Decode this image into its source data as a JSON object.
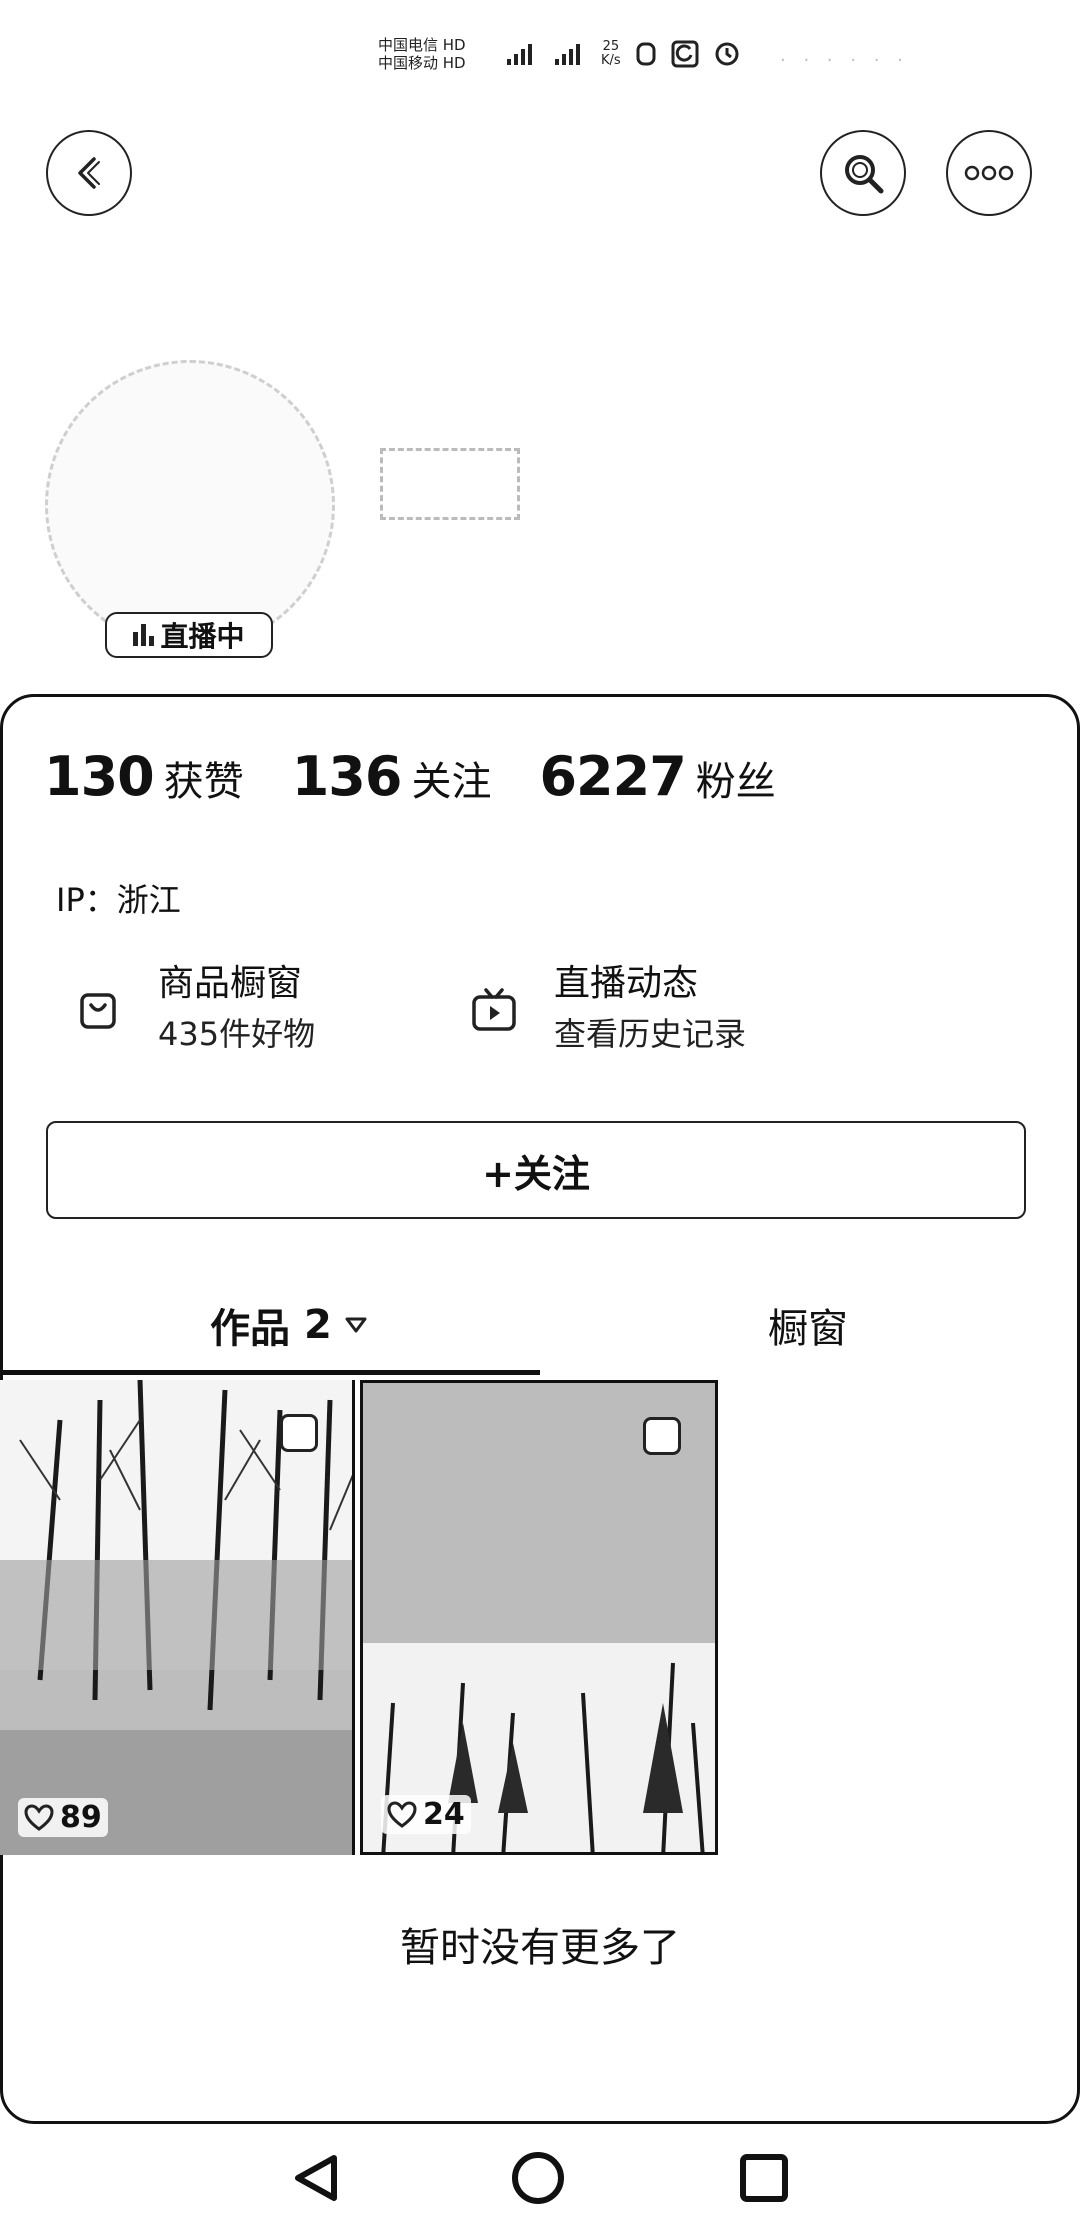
{
  "status_bar": {
    "carrier_line1": "中国电信 HD",
    "carrier_line2": "中国移动 HD",
    "net_speed_value": "25",
    "net_speed_unit": "K/s"
  },
  "header": {
    "live_badge": "直播中"
  },
  "stats": [
    {
      "value": "130",
      "label": "获赞"
    },
    {
      "value": "136",
      "label": "关注"
    },
    {
      "value": "6227",
      "label": "粉丝"
    }
  ],
  "ip": {
    "label": "IP：",
    "value": "浙江"
  },
  "features": {
    "shop": {
      "title": "商品橱窗",
      "subtitle": "435件好物",
      "icon": "shopping-bag-icon"
    },
    "live": {
      "title": "直播动态",
      "subtitle": "查看历史记录",
      "icon": "tv-play-icon"
    }
  },
  "follow_button": "+关注",
  "tabs": {
    "works_label": "作品",
    "works_count": "2",
    "window_label": "橱窗"
  },
  "posts": [
    {
      "likes": "89",
      "icon": "multi-image-icon"
    },
    {
      "likes": "24",
      "icon": "multi-image-icon"
    }
  ],
  "end_message": "暂时没有更多了",
  "icons": {
    "back": "back-arrow-icon",
    "search": "search-icon",
    "more": "more-dots-icon"
  }
}
